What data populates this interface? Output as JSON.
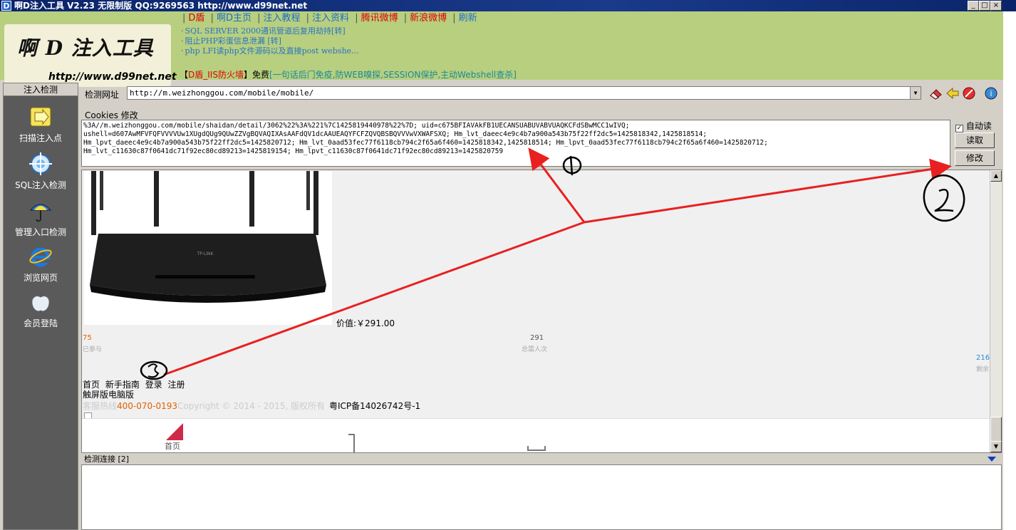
{
  "window": {
    "title": "啊D注入工具 V2.23 无限制版 QQ:9269563 http://www.d99net.net",
    "app_icon": "D",
    "controls": [
      "_",
      "□",
      "×"
    ]
  },
  "banner": {
    "brand": "啊 D 注入工具",
    "site": "http://www.d99net.net",
    "links": [
      {
        "label": "D盾",
        "color": "#e00000"
      },
      {
        "label": "啊D主页",
        "color": "#1a6ec8"
      },
      {
        "label": "注入教程",
        "color": "#1a6ec8"
      },
      {
        "label": "注入资料",
        "color": "#1a6ec8"
      },
      {
        "label": "腾讯微博",
        "color": "#e00000"
      },
      {
        "label": "新浪微博",
        "color": "#e00000"
      },
      {
        "label": "刷新",
        "color": "#1a6ec8"
      }
    ],
    "news": [
      "SQL SERVER 2000通讯管道后复用劫持[转]",
      "阻止PHP彩蛋信息泄漏 [转]",
      "php LFI读php文件源码以及直接post webshe..."
    ],
    "promo_bracket_left": "【",
    "promo_product": "D盾_IIS防火墙",
    "promo_bracket_right": "】",
    "promo_free": "免费",
    "promo_detail": "[一句话后门免疫,防WEB嗅探,SESSION保护,主动Webshell查杀]"
  },
  "sidebar": {
    "header": "注入检测",
    "items": [
      {
        "label": "扫描注入点",
        "icon": "arrow-right-icon"
      },
      {
        "label": "SQL注入检测",
        "icon": "target-icon"
      },
      {
        "label": "管理入口检测",
        "icon": "umbrella-icon"
      },
      {
        "label": "浏览网页",
        "icon": "ie-browser-icon"
      },
      {
        "label": "会员登陆",
        "icon": "apple-icon"
      }
    ]
  },
  "urlbar": {
    "label": "检测网址",
    "value": "http://m.weizhonggou.com/mobile/mobile/"
  },
  "cookies": {
    "label": "Cookies 修改",
    "lines": [
      "%3A//m.weizhonggou.com/mobile/shaidan/detail/3062%22%3A%221%7C1425819440978%22%7D; uid=c675BFIAVAkFB1UECANSUABUVABVUAQKCFdSBwMCC1wIVQ;",
      "ushell=d607AwMFVFQFVVVVUw1XUgdQUg9QUwZZVgBQVAQIXAsAAFdQV1dcAAUEAQYFCFZQVQBSBQVVVwVXWAFSXQ; Hm_lvt_daeec4e9c4b7a900a543b75f22ff2dc5=1425818342,1425818514;",
      "Hm_lpvt_daeec4e9c4b7a900a543b75f22ff2dc5=1425820712; Hm_lvt_0aad53fec77f6118cb794c2f65a6f460=1425818342,1425818514; Hm_lpvt_0aad53fec77f6118cb794c2f65a6f460=1425820712;",
      "Hm_lvt_c11630c87f0641dc71f92ec80cd89213=1425819154; Hm_lpvt_c11630c87f0641dc71f92ec80cd89213=1425820759"
    ],
    "auto_read_label": "自动读",
    "auto_read_checked": true,
    "read_button": "读取",
    "modify_button": "修改"
  },
  "page": {
    "price": "价值:￥291.00",
    "stats": [
      {
        "value": "75",
        "label": "已参与",
        "color": "#e06000"
      },
      {
        "value": "291",
        "label": "总需人次",
        "color": "#555555"
      },
      {
        "value": "216",
        "label": "剩余",
        "color": "#2a8ad8"
      }
    ],
    "nav": [
      "首页",
      "新手指南",
      "登录",
      "注册"
    ],
    "nav2": "触屏版电脑版",
    "hotline_label": "客服热线",
    "hotline_phone": "400-070-0193",
    "copyright": "Copyright © 2014 - 2015, 版权所有",
    "icp": "粤ICP备14026742号-1",
    "bottom_tab": "首页"
  },
  "log": {
    "label": "检测连接",
    "count": "[2]"
  },
  "annotations": {
    "one": "①",
    "two": "②",
    "three": "③",
    "color": "#e82020"
  }
}
